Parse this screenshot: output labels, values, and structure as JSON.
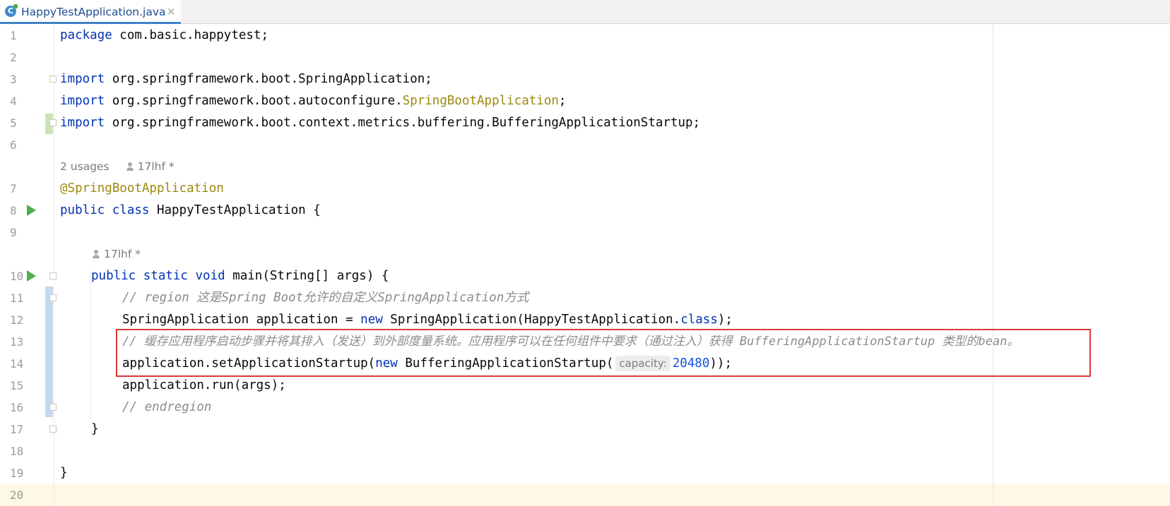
{
  "tab": {
    "icon": "C",
    "filename": "HappyTestApplication.java",
    "close": "×"
  },
  "line_numbers": [
    "1",
    "2",
    "3",
    "4",
    "5",
    "6",
    "7",
    "8",
    "9",
    "10",
    "11",
    "12",
    "13",
    "14",
    "15",
    "16",
    "17",
    "18",
    "19",
    "20"
  ],
  "code": {
    "l1_kw": "package",
    "l1_rest": " com.basic.happytest;",
    "l3_kw": "import",
    "l3_rest": " org.springframework.boot.SpringApplication;",
    "l4_kw": "import",
    "l4_rest": " org.springframework.boot.autoconfigure.",
    "l4_ann": "SpringBootApplication",
    "l4_end": ";",
    "l5_kw": "import",
    "l5_rest": " org.springframework.boot.context.metrics.buffering.BufferingApplicationStartup;",
    "l7_ann": "@SpringBootApplication",
    "l8_kw": "public class",
    "l8_rest": " HappyTestApplication {",
    "l10_kw": "public static void",
    "l10_rest": " main(String[] args) {",
    "l11_cmt": "// region 这是Spring Boot允许的自定义SpringApplication方式",
    "l12_a": "SpringApplication application = ",
    "l12_kw": "new",
    "l12_b": " SpringApplication(HappyTestApplication.",
    "l12_kw2": "class",
    "l12_c": ");",
    "l13_cmt": "// 缓存应用程序启动步骤并将其排入（发送）到外部度量系统。应用程序可以在任何组件中要求（通过注入）获得 BufferingApplicationStartup 类型的bean。",
    "l14_a": "application.setApplicationStartup(",
    "l14_kw": "new",
    "l14_b": " BufferingApplicationStartup(",
    "l14_hint": "capacity:",
    "l14_num": "20480",
    "l14_c": "));",
    "l15": "application.run(args);",
    "l16_cmt": "// endregion",
    "l17": "}",
    "l19": "}"
  },
  "hints": {
    "class_usages": "2 usages",
    "class_author": "17lhf *",
    "method_author": "17lhf *"
  }
}
